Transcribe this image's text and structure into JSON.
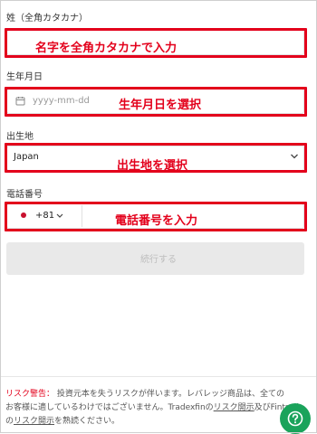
{
  "surname": {
    "label": "姓（全角カタカナ）",
    "annotation": "名字を全角カタカナで入力"
  },
  "birthdate": {
    "label": "生年月日",
    "placeholder": "yyyy-mm-dd",
    "annotation": "生年月日を選択"
  },
  "birthplace": {
    "label": "出生地",
    "value": "Japan",
    "annotation": "出生地を選択"
  },
  "phone": {
    "label": "電話番号",
    "country_code": "+81",
    "annotation": "電話番号を入力"
  },
  "submit_label": "続行する",
  "footer": {
    "warning_label": "リスク警告：",
    "text_1": " 投資元本を失うリスクが伴います。レバレッジ商品は、全ての",
    "text_2": "お客様に適しているわけではございません。Tradexfinの",
    "link_1": "リスク開示",
    "text_3": "及びFintradeの",
    "link_2": "リスク開示",
    "text_4": "を熟読ください。"
  },
  "colors": {
    "accent": "#e3001b",
    "help": "#1aa35b"
  },
  "icons": {
    "calendar": "calendar-icon",
    "chevron": "chevron-down-icon",
    "help": "help-icon",
    "flag": "flag-icon"
  }
}
